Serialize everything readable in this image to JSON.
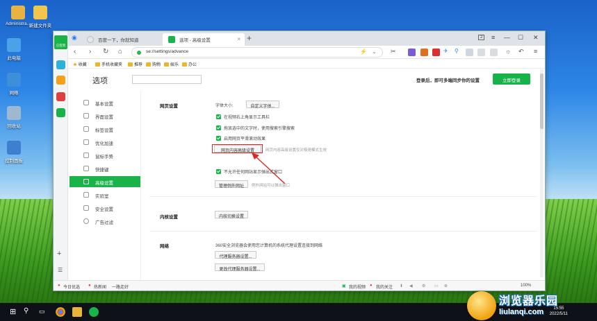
{
  "desktop": {
    "icons": [
      {
        "label": "Administra..."
      },
      {
        "label": "新建文件夹"
      },
      {
        "label": "此电脑"
      },
      {
        "label": "网络"
      },
      {
        "label": "回收站"
      },
      {
        "label": "控制面板"
      }
    ]
  },
  "browser": {
    "tabs": [
      {
        "label": "百度一下，你就知道"
      },
      {
        "label": "选项 - 高级设置"
      }
    ],
    "tab_count": "2",
    "url": "se://settings/advance",
    "favorites": [
      "收藏",
      "手机收藏夹",
      "推荐",
      "购物",
      "娱乐",
      "办公"
    ],
    "side_badge": "已签到"
  },
  "settings": {
    "page_title": "选项",
    "sync_tip": "登录后，即可多端同步你的设置",
    "login_button": "立即登录",
    "menu": [
      {
        "label": "基本设置"
      },
      {
        "label": "界面设置"
      },
      {
        "label": "标签设置"
      },
      {
        "label": "优化加速"
      },
      {
        "label": "鼠标手势"
      },
      {
        "label": "快捷键"
      },
      {
        "label": "高级设置"
      },
      {
        "label": "实验室"
      },
      {
        "label": "安全设置"
      },
      {
        "label": "广告过滤"
      }
    ],
    "webpage": {
      "title": "网页设置",
      "font_size_label": "字体大小:",
      "custom_font_button": "自定义字体...",
      "options": [
        "在视频右上角显示工具栏",
        "拖放选中的文字时，使用搜索引擎搜索",
        "启用网页平滑滚动效果"
      ],
      "content_button": "网页内容高级设置",
      "content_hint": "网页内容高级设置仅对极速模式生效",
      "popup_option": "不允许任何网站显示弹出式窗口",
      "exceptions_button": "管理例外网址",
      "exceptions_hint": "例外网站可以弹出窗口"
    },
    "kernel": {
      "title": "内核设置",
      "button": "内核切换设置"
    },
    "network": {
      "title": "网络",
      "desc": "360安全浏览器会使用您计算机的系统代理设置连接到网络",
      "proxy_button": "代理服务器设置...",
      "change_proxy_button": "更改代理服务器设置..."
    }
  },
  "statusbar": {
    "left": [
      "今日优选",
      "热新闻",
      "一路走好"
    ],
    "right": [
      "我的视频",
      "我的关注",
      "100%"
    ]
  },
  "taskbar": {
    "time": "15:55",
    "date": "2022/5/11"
  },
  "watermark": {
    "title": "浏览器乐园",
    "sub": "liulanqi.com"
  },
  "colors": {
    "accent": "#19b34a",
    "highlight": "#e02424"
  }
}
